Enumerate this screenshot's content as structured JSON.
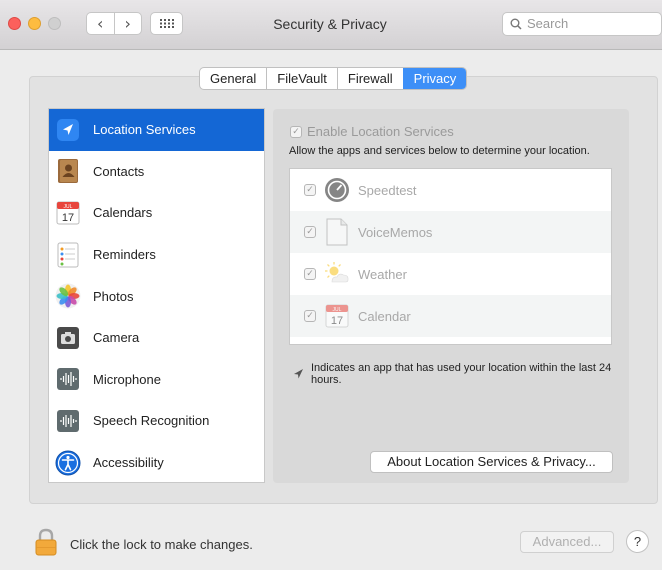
{
  "window": {
    "title": "Security & Privacy",
    "search_placeholder": "Search",
    "back_glyph": "‹",
    "forward_glyph": "›"
  },
  "tabs": [
    {
      "label": "General",
      "active": false
    },
    {
      "label": "FileVault",
      "active": false
    },
    {
      "label": "Firewall",
      "active": false
    },
    {
      "label": "Privacy",
      "active": true
    }
  ],
  "sidebar": {
    "items": [
      {
        "label": "Location Services",
        "icon": "location-arrow-icon",
        "selected": true
      },
      {
        "label": "Contacts",
        "icon": "contacts-icon",
        "selected": false
      },
      {
        "label": "Calendars",
        "icon": "calendar-icon",
        "selected": false
      },
      {
        "label": "Reminders",
        "icon": "reminders-icon",
        "selected": false
      },
      {
        "label": "Photos",
        "icon": "photos-icon",
        "selected": false
      },
      {
        "label": "Camera",
        "icon": "camera-icon",
        "selected": false
      },
      {
        "label": "Microphone",
        "icon": "microphone-icon",
        "selected": false
      },
      {
        "label": "Speech Recognition",
        "icon": "speech-recognition-icon",
        "selected": false
      },
      {
        "label": "Accessibility",
        "icon": "accessibility-icon",
        "selected": false
      }
    ]
  },
  "location": {
    "enable_label": "Enable Location Services",
    "enable_checked": true,
    "description": "Allow the apps and services below to determine your location.",
    "apps": [
      {
        "name": "Speedtest",
        "checked": true,
        "icon": "speedtest-icon"
      },
      {
        "name": "VoiceMemos",
        "checked": true,
        "icon": "document-icon"
      },
      {
        "name": "Weather",
        "checked": true,
        "icon": "weather-icon"
      },
      {
        "name": "Calendar",
        "checked": true,
        "icon": "calendar-icon"
      }
    ],
    "calendar_icon_month": "JUL",
    "calendar_icon_day": "17",
    "note": "Indicates an app that has used your location within the last 24 hours.",
    "about_button": "About Location Services & Privacy..."
  },
  "footer": {
    "lock_text": "Click the lock to make changes.",
    "advanced_button": "Advanced...",
    "help_button": "?"
  },
  "colors": {
    "selection_blue": "#1467d5",
    "tab_active_blue": "#3d8ff7"
  }
}
